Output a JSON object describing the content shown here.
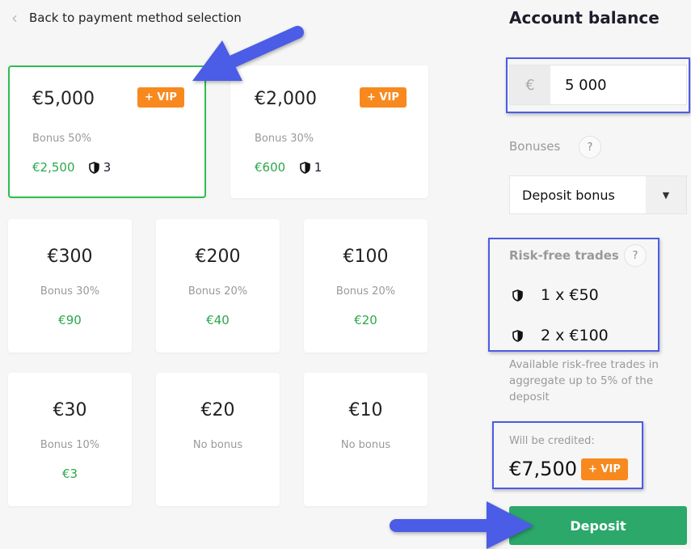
{
  "back_link": "Back to payment method selection",
  "packages": [
    {
      "amount": "€5,000",
      "vip": "+ VIP",
      "bonus": "Bonus 50%",
      "bonus_amount": "€2,500",
      "risk_free_count": "3",
      "selected": true
    },
    {
      "amount": "€2,000",
      "vip": "+ VIP",
      "bonus": "Bonus 30%",
      "bonus_amount": "€600",
      "risk_free_count": "1",
      "selected": false
    },
    {
      "amount": "€300",
      "bonus": "Bonus 30%",
      "bonus_amount": "€90"
    },
    {
      "amount": "€200",
      "bonus": "Bonus 20%",
      "bonus_amount": "€40"
    },
    {
      "amount": "€100",
      "bonus": "Bonus 20%",
      "bonus_amount": "€20"
    },
    {
      "amount": "€30",
      "bonus": "Bonus 10%",
      "bonus_amount": "€3"
    },
    {
      "amount": "€20",
      "bonus": "No bonus"
    },
    {
      "amount": "€10",
      "bonus": "No bonus"
    }
  ],
  "sidebar": {
    "title": "Account balance",
    "currency_symbol": "€",
    "amount_value": "5 000",
    "bonuses_label": "Bonuses",
    "help": "?",
    "bonus_select": "Deposit bonus",
    "risk_free_label": "Risk-free trades",
    "risk_free": [
      "1 x €50",
      "2 x €100"
    ],
    "note": "Available risk-free trades in aggregate up to 5% of the deposit",
    "credited_label": "Will be credited:",
    "credited_amount": "€7,500",
    "credited_vip": "+ VIP",
    "deposit_button": "Deposit"
  },
  "colors": {
    "accent_green": "#2ba86a",
    "vip_orange": "#f7891e",
    "selected_border": "#2ebd4f",
    "annotation_blue": "#4b5ce6"
  }
}
